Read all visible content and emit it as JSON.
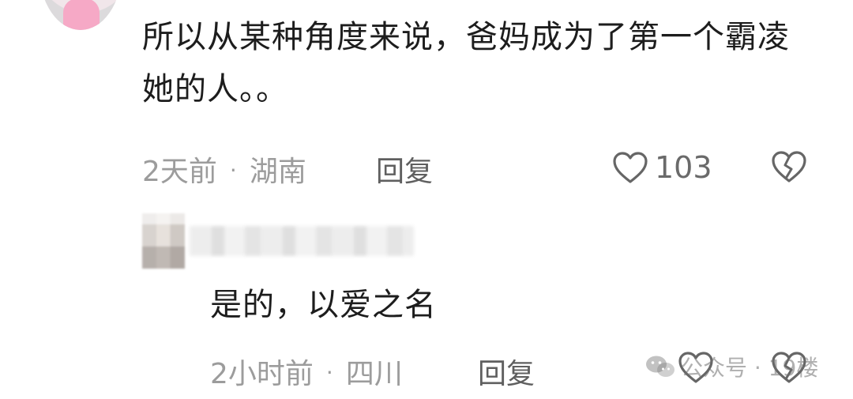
{
  "comment": {
    "text": "所以从某种角度来说，爸妈成为了第一个霸凌她的人。。",
    "time": "2天前",
    "location": "湖南",
    "reply_label": "回复",
    "like_count": "103"
  },
  "reply": {
    "text": "是的，以爱之名",
    "time": "2小时前",
    "location": "四川",
    "reply_label": "回复"
  },
  "watermark": {
    "text": "公众号 · 19楼"
  },
  "icons": {
    "like": "heart-outline-icon",
    "dislike": "broken-heart-icon",
    "watermark": "wechat-icon"
  },
  "colors": {
    "text": "#1d1d1d",
    "meta": "#9c9c9c",
    "reply": "#5f5f5f"
  }
}
